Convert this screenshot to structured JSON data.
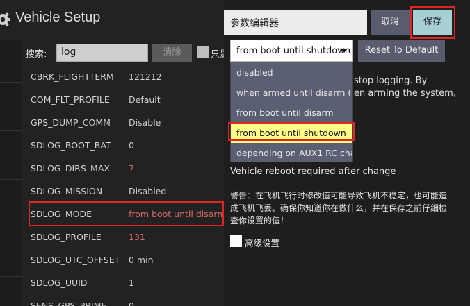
{
  "header": {
    "title": "Vehicle Setup",
    "icon": "gear-icon"
  },
  "search": {
    "label": "搜索:",
    "value": "log",
    "clear_label": "清除",
    "only_modified_label": "只显"
  },
  "params": [
    {
      "name": "CBRK_FLIGHTTERM",
      "value": "121212",
      "value_color": "normal"
    },
    {
      "name": "COM_FLT_PROFILE",
      "value": "Default",
      "value_color": "normal"
    },
    {
      "name": "GPS_DUMP_COMM",
      "value": "Disable",
      "value_color": "normal"
    },
    {
      "name": "SDLOG_BOOT_BAT",
      "value": "0",
      "value_color": "normal"
    },
    {
      "name": "SDLOG_DIRS_MAX",
      "value": "7",
      "value_color": "red"
    },
    {
      "name": "SDLOG_MISSION",
      "value": "Disabled",
      "value_color": "normal"
    },
    {
      "name": "SDLOG_MODE",
      "value": "from boot until disarm",
      "value_color": "red"
    },
    {
      "name": "SDLOG_PROFILE",
      "value": "131",
      "value_color": "red"
    },
    {
      "name": "SDLOG_UTC_OFFSET",
      "value": "0 min",
      "value_color": "normal"
    },
    {
      "name": "SDLOG_UUID",
      "value": "1",
      "value_color": "normal"
    },
    {
      "name": "SENS_GPS_PRIME",
      "value": "0",
      "value_color": "normal"
    }
  ],
  "editor": {
    "title": "参数编辑器",
    "cancel_label": "取消",
    "save_label": "保存",
    "selected_value": "from boot until shutdown",
    "reset_label": "Reset To Default",
    "description_lines": [
      "stop logging. By",
      "en arming the system,"
    ],
    "reboot_note": "Vehicle reboot required after change",
    "warning": "警告：在飞机飞行时修改值可能导致飞机不稳定，也可能造成飞机飞丢。确保你知道你在做什么，并在保存之前仔细检查你设置的值！",
    "advanced_label": "高级设置",
    "options": [
      {
        "label": "disabled",
        "selected": false
      },
      {
        "label": "when armed until disarm (def",
        "selected": false
      },
      {
        "label": "from boot until disarm",
        "selected": false
      },
      {
        "label": "from boot until shutdown",
        "selected": true
      },
      {
        "label": "depending on AUX1 RC chann",
        "selected": false
      }
    ]
  },
  "colors": {
    "highlight_border": "#e0261f",
    "selected_option": "#ffff88",
    "save_button": "#a6cfd6",
    "red_value": "#d86a6a"
  }
}
